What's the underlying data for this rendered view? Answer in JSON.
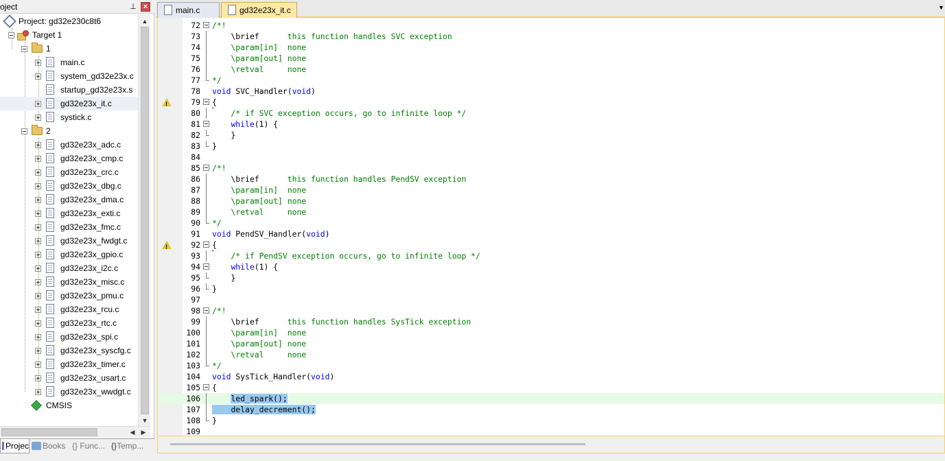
{
  "panel": {
    "title": "oject",
    "pin": "⩽",
    "close": "×"
  },
  "tree": {
    "project_label": "Project: gd32e230c8t6",
    "target_label": "Target 1",
    "group1_label": "1",
    "group1_files": [
      "main.c",
      "system_gd32e23x.c",
      "startup_gd32e23x.s",
      "gd32e23x_it.c",
      "systick.c"
    ],
    "group2_label": "2",
    "group2_files": [
      "gd32e23x_adc.c",
      "gd32e23x_cmp.c",
      "gd32e23x_crc.c",
      "gd32e23x_dbg.c",
      "gd32e23x_dma.c",
      "gd32e23x_exti.c",
      "gd32e23x_fmc.c",
      "gd32e23x_fwdgt.c",
      "gd32e23x_gpio.c",
      "gd32e23x_i2c.c",
      "gd32e23x_misc.c",
      "gd32e23x_pmu.c",
      "gd32e23x_rcu.c",
      "gd32e23x_rtc.c",
      "gd32e23x_spi.c",
      "gd32e23x_syscfg.c",
      "gd32e23x_timer.c",
      "gd32e23x_usart.c",
      "gd32e23x_wwdgt.c"
    ],
    "cmsis_label": "CMSIS"
  },
  "bottom_tabs": {
    "project": "Project",
    "books": "Books",
    "functions": "{} Func...",
    "templates": "Temp..."
  },
  "editor_tabs": {
    "tab1": "main.c",
    "tab2": "gd32e23x_it.c"
  },
  "code": {
    "l72": "/*!",
    "l73a": "    \\brief      ",
    "l73b": "this function handles SVC exception",
    "l74": "    \\param[in]  none",
    "l75": "    \\param[out] none",
    "l76": "    \\retval     none",
    "l77": "*/",
    "l78a": "void",
    "l78b": " SVC_Handler(",
    "l78c": "void",
    "l78d": ")",
    "l79": "{",
    "l80": "    /* if SVC exception occurs, go to infinite loop */",
    "l81a": "    ",
    "l81b": "while",
    "l81c": "(1) {",
    "l82": "    }",
    "l83": "}",
    "l84": "",
    "l85": "/*!",
    "l86a": "    \\brief      ",
    "l86b": "this function handles PendSV exception",
    "l87": "    \\param[in]  none",
    "l88": "    \\param[out] none",
    "l89": "    \\retval     none",
    "l90": "*/",
    "l91a": "void",
    "l91b": " PendSV_Handler(",
    "l91c": "void",
    "l91d": ")",
    "l92": "{",
    "l93": "    /* if PendSV exception occurs, go to infinite loop */",
    "l94a": "    ",
    "l94b": "while",
    "l94c": "(1) {",
    "l95": "    }",
    "l96": "}",
    "l97": "",
    "l98": "/*!",
    "l99a": "    \\brief      ",
    "l99b": "this function handles SysTick exception",
    "l100": "    \\param[in]  none",
    "l101": "    \\param[out] none",
    "l102": "    \\retval     none",
    "l103": "*/",
    "l104a": "void",
    "l104b": " SysTick_Handler(",
    "l104c": "void",
    "l104d": ")",
    "l105": "{",
    "l106a": "    ",
    "l106b": "led_spark();",
    "l107a": "    ",
    "l107b": "delay_decrement();",
    "l108": "}",
    "l109": ""
  },
  "line_numbers": [
    "72",
    "73",
    "74",
    "75",
    "76",
    "77",
    "78",
    "79",
    "80",
    "81",
    "82",
    "83",
    "84",
    "85",
    "86",
    "87",
    "88",
    "89",
    "90",
    "91",
    "92",
    "93",
    "94",
    "95",
    "96",
    "97",
    "98",
    "99",
    "100",
    "101",
    "102",
    "103",
    "104",
    "105",
    "106",
    "107",
    "108",
    "109"
  ],
  "colors": {
    "comment": "#008000",
    "keyword": "#0000ff",
    "selection": "#99c9ef",
    "current_line": "#e6fbe6",
    "active_tab": "#fce9a8"
  }
}
